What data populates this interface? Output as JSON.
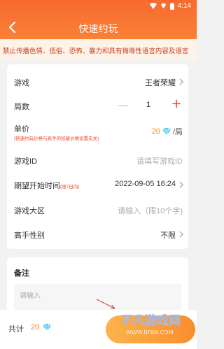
{
  "status_bar": {
    "time": "4:14",
    "icons": [
      "wifi-icon",
      "diamond-icon",
      "battery-icon"
    ]
  },
  "header": {
    "title": "快速约玩",
    "back_icon": "back-arrow-icon",
    "bg_color": "#f86a2f"
  },
  "notice": {
    "text": "禁止传播色情、低俗、恐怖、暴力和具有侮辱性语言内容及语言"
  },
  "form": {
    "game": {
      "label": "游戏",
      "value": "王者荣耀"
    },
    "rounds": {
      "label": "局数",
      "value": "1",
      "minus": "—",
      "plus": "+"
    },
    "price": {
      "label": "单价",
      "note": "(快速约玩价格与高手的技能价格设置无关)",
      "value": "20",
      "unit": "/局"
    },
    "game_id": {
      "label": "游戏ID",
      "placeholder": "请填写游戏ID"
    },
    "start_time": {
      "label": "期望开始时间",
      "hint": "(限7日内)",
      "value": "2022-09-05 16:24"
    },
    "region": {
      "label": "游戏大区",
      "placeholder": "请输入（限10个字)"
    },
    "gender": {
      "label": "高手性别",
      "value": "不限"
    }
  },
  "remark": {
    "label": "备注",
    "placeholder": "请输入"
  },
  "bottom": {
    "total_label": "共计",
    "total_value": "20"
  },
  "colors": {
    "accent_orange": "#f98136",
    "price_orange": "#f08a2c",
    "red": "#e8432b",
    "diamond_blue": "#5ec8f2"
  },
  "watermark": {
    "text": "不凡游戏网",
    "domain": "WWW.BFAN.COM"
  }
}
